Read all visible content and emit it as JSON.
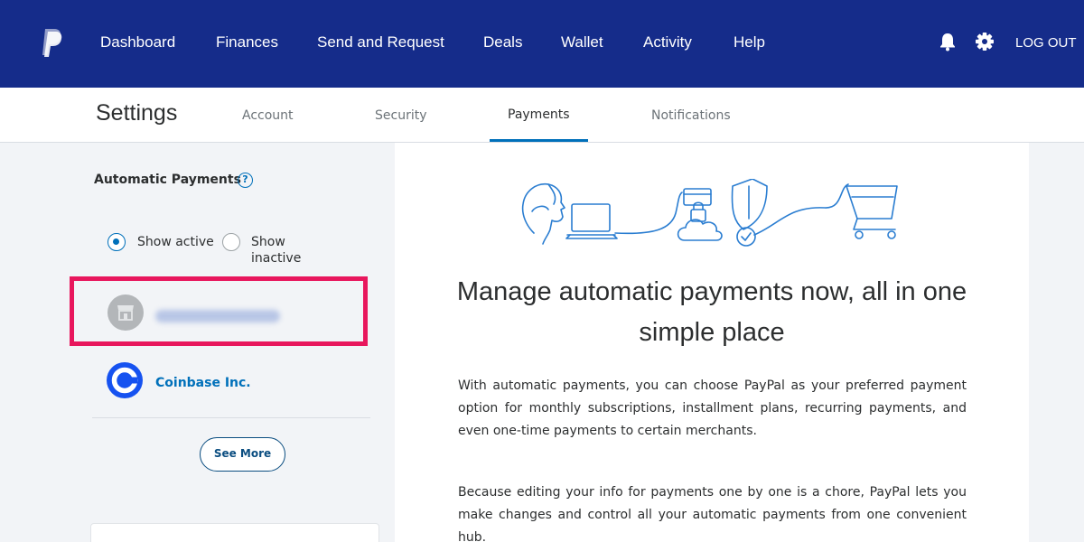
{
  "topnav": {
    "items": [
      "Dashboard",
      "Finances",
      "Send and Request",
      "Deals",
      "Wallet",
      "Activity",
      "Help"
    ],
    "icons": [
      "bell-icon",
      "gear-icon"
    ],
    "logout": "LOG OUT",
    "background": "#152c8a"
  },
  "subnav": {
    "title": "Settings",
    "tabs": [
      "Account",
      "Security",
      "Payments",
      "Notifications"
    ],
    "active_tab": "Payments"
  },
  "sidebar": {
    "title": "Automatic Payments",
    "help": "?",
    "filters": {
      "active_label": "Show active",
      "inactive_label_line1": "Show",
      "inactive_label_line2": "inactive",
      "selected": "Show active"
    },
    "merchants": [
      {
        "icon": "store-icon",
        "name_hidden": true
      },
      {
        "name": "Coinbase Inc.",
        "icon": "coinbase-logo"
      }
    ],
    "see_more": "See More"
  },
  "main": {
    "headline": "Manage automatic payments now, all in one simple place",
    "paragraph1": "With automatic payments, you can choose PayPal as your preferred payment option for monthly subscriptions, installment plans, recurring payments, and even one-time payments to certain merchants.",
    "paragraph2": "Because editing your info for payments one by one is a chore, PayPal lets you make changes and control all your automatic payments from one convenient hub."
  },
  "colors": {
    "accent": "#0070ba",
    "highlight": "#e8175d",
    "coinbase": "#1652f0"
  }
}
